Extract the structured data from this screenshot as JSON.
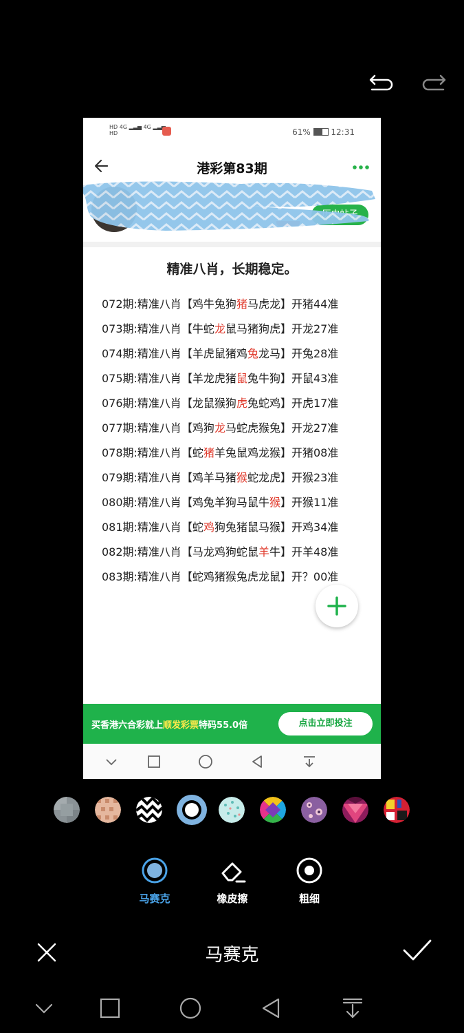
{
  "editor": {
    "mode_title": "马赛克",
    "tools": [
      {
        "label": "马赛克",
        "icon": "mosaic-circle-icon",
        "active": true
      },
      {
        "label": "橡皮擦",
        "icon": "eraser-icon",
        "active": false
      },
      {
        "label": "粗细",
        "icon": "thickness-icon",
        "active": false
      }
    ],
    "swatches": [
      "pixel-grey",
      "dots-peach",
      "zigzag-bw",
      "ring-blue",
      "dots-teal",
      "geo-colorful",
      "floral-purple",
      "triangles-magenta",
      "blocks-red"
    ],
    "accent_color": "#4aa3e8"
  },
  "preview": {
    "status": {
      "battery": "61%",
      "time": "12:31",
      "net1": "4G",
      "net2": "4G",
      "hd": "HD"
    },
    "app_title": "港彩第83期",
    "history_button": "历史帖子",
    "post_title": "精准八肖，长期稳定。",
    "lines": [
      {
        "pre": "072期:精准八肖【鸡牛兔狗",
        "hl": "猪",
        "post": "马虎龙】开猪44准"
      },
      {
        "pre": "073期:精准八肖【牛蛇",
        "hl": "龙",
        "post": "鼠马猪狗虎】开龙27准"
      },
      {
        "pre": "074期:精准八肖【羊虎鼠猪鸡",
        "hl": "兔",
        "post": "龙马】开兔28准"
      },
      {
        "pre": "075期:精准八肖【羊龙虎猪",
        "hl": "鼠",
        "post": "兔牛狗】开鼠43准"
      },
      {
        "pre": "076期:精准八肖【龙鼠猴狗",
        "hl": "虎",
        "post": "兔蛇鸡】开虎17准"
      },
      {
        "pre": "077期:精准八肖【鸡狗",
        "hl": "龙",
        "post": "马蛇虎猴兔】开龙27准"
      },
      {
        "pre": "078期:精准八肖【蛇",
        "hl": "猪",
        "post": "羊兔鼠鸡龙猴】开猪08准"
      },
      {
        "pre": "079期:精准八肖【鸡羊马猪",
        "hl": "猴",
        "post": "蛇龙虎】开猴23准"
      },
      {
        "pre": "080期:精准八肖【鸡兔羊狗马鼠牛",
        "hl": "猴",
        "post": "】开猴11准"
      },
      {
        "pre": "081期:精准八肖【蛇",
        "hl": "鸡",
        "post": "狗兔猪鼠马猴】开鸡34准"
      },
      {
        "pre": "082期:精准八肖【马龙鸡狗蛇鼠",
        "hl": "羊",
        "post": "牛】开羊48准"
      },
      {
        "pre": "083期:精准八肖【蛇鸡猪猴兔虎龙鼠】开？00准",
        "hl": "",
        "post": ""
      }
    ],
    "ad": {
      "pre": "买香港六合彩就上",
      "highlight": "顺发彩票",
      "post": "特码55.0倍",
      "button": "点击立即投注"
    },
    "colors": {
      "green": "#1fb24b",
      "highlight_red": "#e0392b"
    }
  }
}
